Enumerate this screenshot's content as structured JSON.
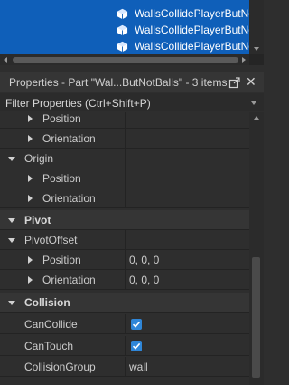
{
  "explorer": {
    "items": [
      "WallsCollidePlayerButNotBalls",
      "WallsCollidePlayerButNotBalls",
      "WallsCollidePlayerButNotBalls"
    ]
  },
  "properties": {
    "title": "Properties - Part \"Wal...ButNotBalls\" - 3 items",
    "filter_placeholder": "Filter Properties (Ctrl+Shift+P)",
    "rows": [
      {
        "label": "Position"
      },
      {
        "label": "Orientation"
      },
      {
        "label": "Origin"
      },
      {
        "label": "Position"
      },
      {
        "label": "Orientation"
      },
      {
        "label": "Pivot"
      },
      {
        "label": "PivotOffset"
      },
      {
        "label": "Position",
        "value": "0, 0, 0"
      },
      {
        "label": "Orientation",
        "value": "0, 0, 0"
      },
      {
        "label": "Collision"
      },
      {
        "label": "CanCollide",
        "checked": true
      },
      {
        "label": "CanTouch",
        "checked": true
      },
      {
        "label": "CollisionGroup",
        "value": "wall"
      }
    ]
  },
  "colors": {
    "selection": "#0f5fb9",
    "checkbox": "#2f86d8",
    "panel": "#2e2e2e"
  }
}
